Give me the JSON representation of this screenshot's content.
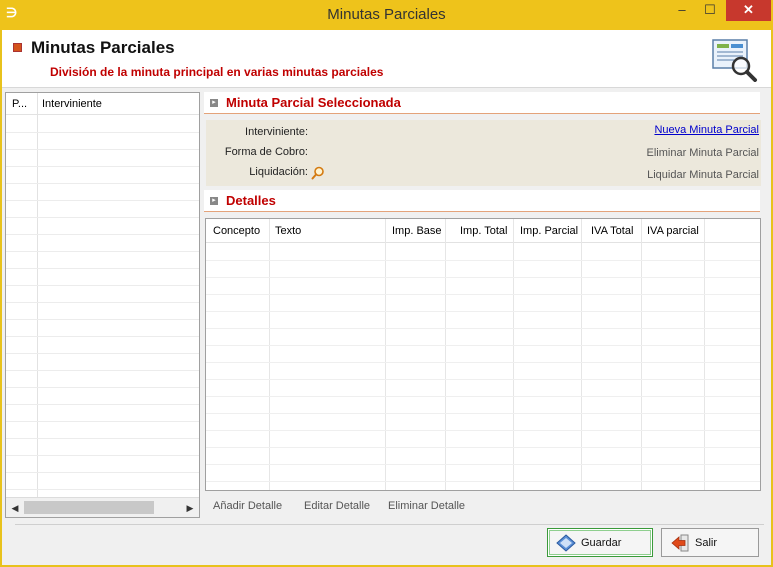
{
  "window": {
    "title": "Minutas Parciales",
    "controls": {
      "minimize": "–",
      "maximize": "☐",
      "close": "✕"
    }
  },
  "header": {
    "title": "Minutas Parciales",
    "subtitle": "División de la minuta principal en varias minutas parciales"
  },
  "left_grid": {
    "columns": [
      "P...",
      "Interviniente"
    ]
  },
  "selected_section": {
    "title": "Minuta Parcial Seleccionada",
    "fields": {
      "interviniente_label": "Interviniente:",
      "forma_cobro_label": "Forma de Cobro:",
      "liquidacion_label": "Liquidación:"
    },
    "actions": {
      "nueva": "Nueva Minuta Parcial",
      "eliminar": "Eliminar Minuta Parcial",
      "liquidar": "Liquidar Minuta Parcial"
    }
  },
  "detalles_section": {
    "title": "Detalles",
    "columns": [
      "Concepto",
      "Texto",
      "Imp. Base",
      "Imp. Total",
      "Imp. Parcial",
      "IVA Total",
      "IVA parcial"
    ],
    "actions": {
      "anadir": "Añadir Detalle",
      "editar": "Editar Detalle",
      "eliminar": "Eliminar Detalle"
    }
  },
  "footer": {
    "guardar": "Guardar",
    "salir": "Salir"
  },
  "colors": {
    "title_bar": "#eec31b",
    "accent_red": "#c00000",
    "close_button": "#c7382d",
    "link": "#0000cc"
  },
  "icons": {
    "app": "app-logo-icon",
    "header": "document-search-icon",
    "liquidacion": "magnifier-icon",
    "guardar": "save-diamond-icon",
    "salir": "exit-arrow-icon"
  }
}
